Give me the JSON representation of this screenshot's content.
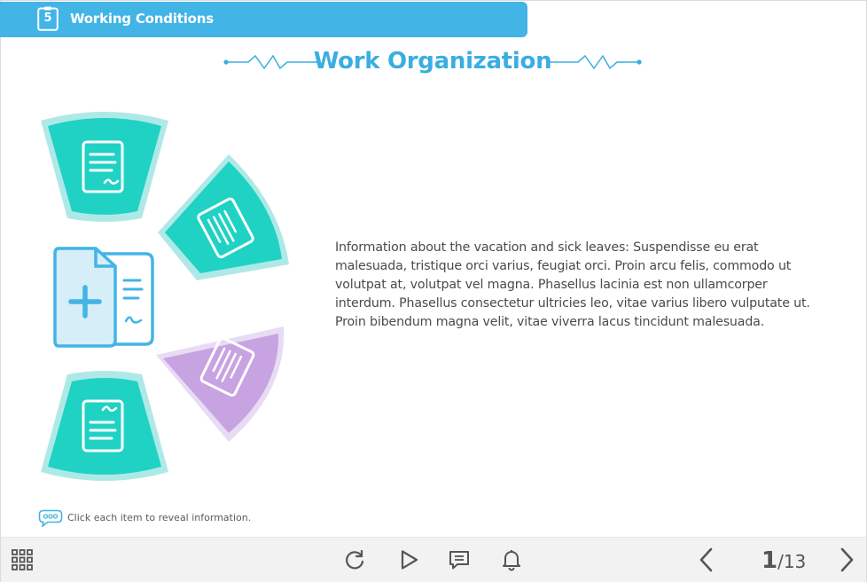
{
  "header": {
    "chapter_number": "5",
    "chapter_title": "Working Conditions"
  },
  "page": {
    "title": "Work Organization"
  },
  "content": {
    "info_text": "Information about the vacation and sick leaves: Suspendisse eu erat malesuada, tristique orci varius, feugiat orci. Proin arcu felis, commodo ut volutpat at, volutpat vel magna. Phasellus lacinia est non ullamcorper interdum. Phasellus consectetur ultricies leo, vitae varius libero vulputate ut. Proin bibendum magna velit, vitae viverra lacus tincidunt malesuada."
  },
  "hint": {
    "text": "Click each item to reveal information."
  },
  "navigation": {
    "current_page": "1",
    "total_pages": "/13"
  },
  "colors": {
    "accent": "#42b4e6",
    "teal": "#1fd2c4",
    "purple": "#c8a3e2",
    "toolbar_bg": "#f2f2f2"
  },
  "icons": {
    "menu": "grid-icon",
    "replay": "replay-icon",
    "play": "play-icon",
    "comments": "comment-icon",
    "notifications": "bell-icon",
    "prev": "chevron-left-icon",
    "next": "chevron-right-icon"
  }
}
